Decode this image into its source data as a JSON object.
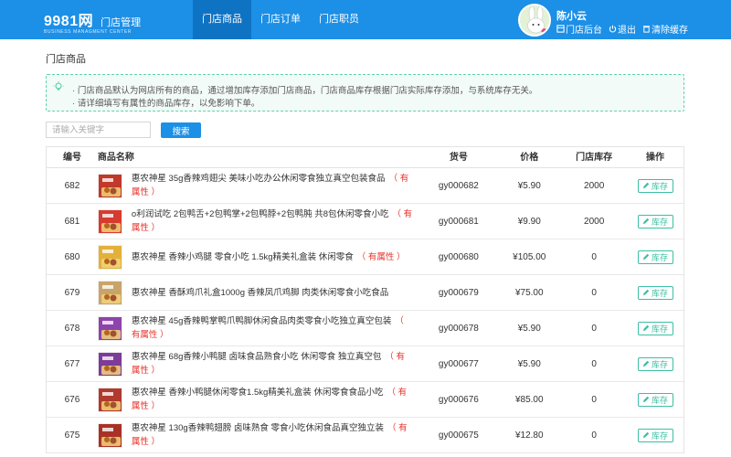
{
  "header": {
    "brand_name": "9981网",
    "brand_sub": "门店管理",
    "brand_en": "BUSINESS MANAGMENT CENTER",
    "nav": [
      {
        "label": "门店商品",
        "active": true
      },
      {
        "label": "门店订单",
        "active": false
      },
      {
        "label": "门店职员",
        "active": false
      }
    ],
    "user": {
      "name": "陈小云",
      "links": [
        "门店后台",
        "退出",
        "清除缓存"
      ]
    }
  },
  "page": {
    "title": "门店商品",
    "notice": [
      "门店商品默认为网店所有的商品，通过增加库存添加门店商品，门店商品库存根据门店实际库存添加，与系统库存无关。",
      "请详细填写有属性的商品库存，以免影响下单。"
    ],
    "search": {
      "placeholder": "请输入关键字",
      "value": "",
      "button": "搜索"
    }
  },
  "table": {
    "headers": [
      "编号",
      "商品名称",
      "货号",
      "价格",
      "门店库存",
      "操作"
    ],
    "attr_tag": "（ 有属性 ）",
    "stock_button": "库存",
    "rows": [
      {
        "id": "682",
        "name": "惠农神星 35g香辣鸡翅尖 美味小吃办公休闲零食独立真空包装食品",
        "attr": "（ 有属性 ）",
        "sku": "gy000682",
        "price": "¥5.90",
        "stock": "2000",
        "thumb_color": "#c0392b"
      },
      {
        "id": "681",
        "name": "o利润试吃 2包鸭舌+2包鸭掌+2包鸭脖+2包鸭肫 共8包休闲零食小吃",
        "attr": "（ 有属性 ）",
        "sku": "gy000681",
        "price": "¥9.90",
        "stock": "2000",
        "thumb_color": "#d63b2f"
      },
      {
        "id": "680",
        "name": "惠农神星 香辣小鸡腿 零食小吃 1.5kg精美礼盒装 休闲零食",
        "attr": "（ 有属性 ）",
        "sku": "gy000680",
        "price": "¥105.00",
        "stock": "0",
        "thumb_color": "#e3b13b"
      },
      {
        "id": "679",
        "name": "惠农神星 香酥鸡爪礼盒1000g 香辣凤爪鸡脚 肉类休闲零食小吃食品",
        "attr": "",
        "sku": "gy000679",
        "price": "¥75.00",
        "stock": "0",
        "thumb_color": "#c9a46a"
      },
      {
        "id": "678",
        "name": "惠农神星 45g香辣鸭掌鸭爪鸭脚休闲食品肉类零食小吃独立真空包装",
        "attr": "（ 有属性 ）",
        "sku": "gy000678",
        "price": "¥5.90",
        "stock": "0",
        "thumb_color": "#8e44ad"
      },
      {
        "id": "677",
        "name": "惠农神星 68g香辣小鸭腿 卤味食品熟食小吃 休闲零食 独立真空包",
        "attr": "（ 有属性 ）",
        "sku": "gy000677",
        "price": "¥5.90",
        "stock": "0",
        "thumb_color": "#7d3c98"
      },
      {
        "id": "676",
        "name": "惠农神星 香辣小鸭腿休闲零食1.5kg精美礼盒装 休闲零食食品小吃",
        "attr": "（ 有属性 ）",
        "sku": "gy000676",
        "price": "¥85.00",
        "stock": "0",
        "thumb_color": "#b03a2e"
      },
      {
        "id": "675",
        "name": "惠农神星 130g香辣鸭翅膀 卤味熟食 零食小吃休闲食品真空独立装",
        "attr": "（ 有属性 ）",
        "sku": "gy000675",
        "price": "¥12.80",
        "stock": "0",
        "thumb_color": "#a93226"
      }
    ]
  }
}
